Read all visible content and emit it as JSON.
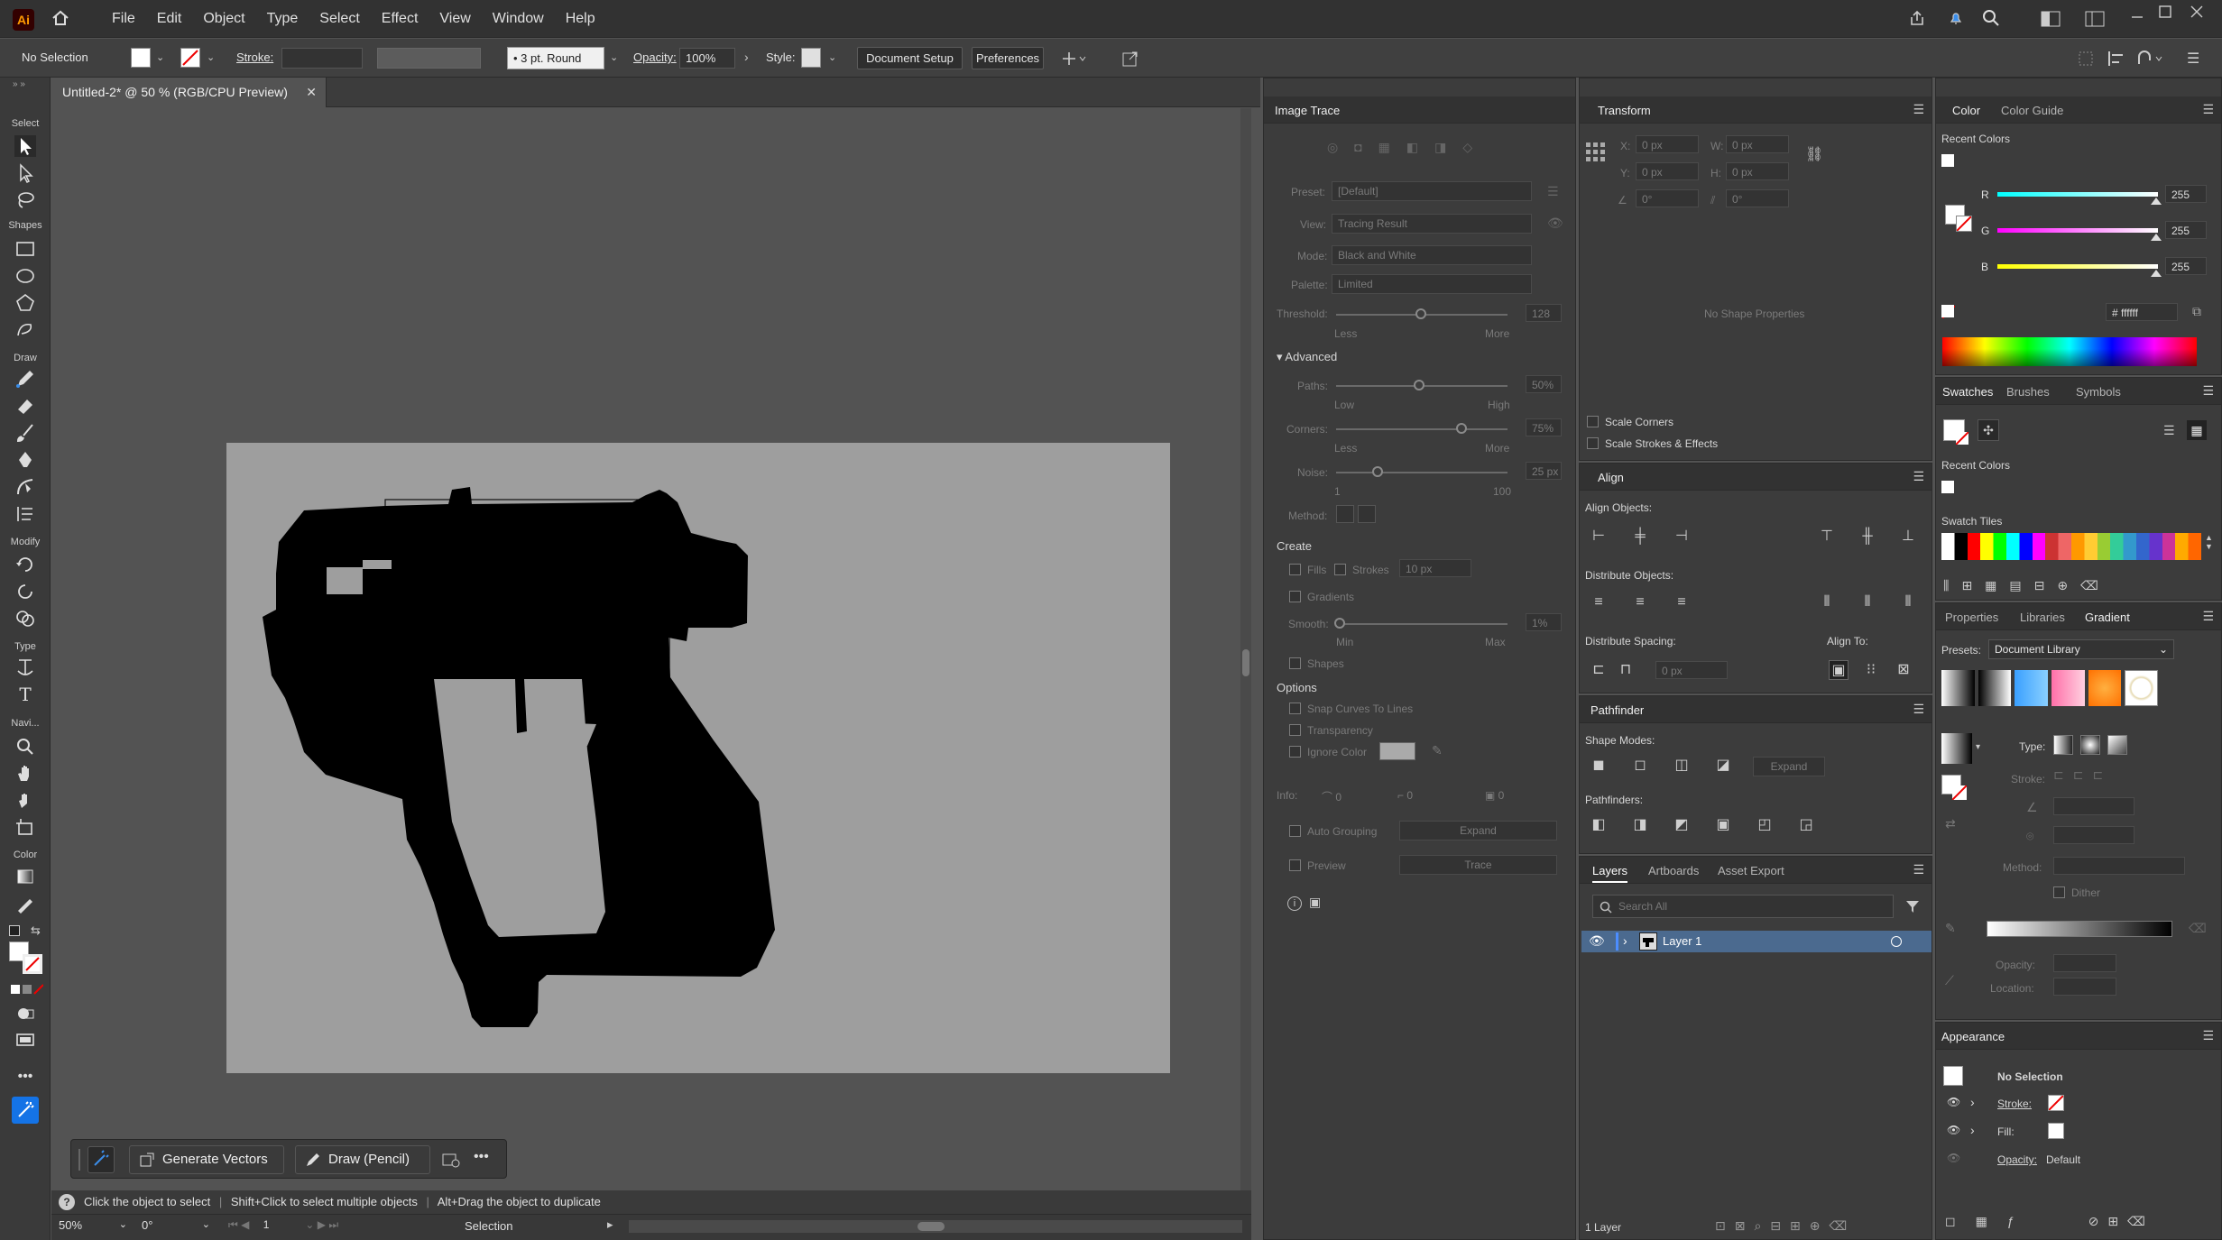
{
  "app": {
    "logo": "Ai",
    "menu": [
      "File",
      "Edit",
      "Object",
      "Type",
      "Select",
      "Effect",
      "View",
      "Window",
      "Help"
    ]
  },
  "control": {
    "selection": "No Selection",
    "stroke_label": "Stroke:",
    "brush": "3 pt. Round",
    "opacity_label": "Opacity:",
    "opacity": "100%",
    "style_label": "Style:",
    "doc_setup": "Document Setup",
    "preferences": "Preferences"
  },
  "doc": {
    "tab_title": "Untitled-2* @ 50 % (RGB/CPU Preview)"
  },
  "tools": {
    "select": "Select",
    "shapes": "Shapes",
    "draw": "Draw",
    "modify": "Modify",
    "type": "Type",
    "navi": "Navi...",
    "color": "Color"
  },
  "trace": {
    "title": "Image Trace",
    "preset_label": "Preset:",
    "preset": "[Default]",
    "view_label": "View:",
    "view": "Tracing Result",
    "mode_label": "Mode:",
    "mode": "Black and White",
    "palette_label": "Palette:",
    "palette": "Limited",
    "threshold_label": "Threshold:",
    "threshold": "128",
    "less": "Less",
    "more": "More",
    "advanced": "Advanced",
    "paths_label": "Paths:",
    "paths": "50%",
    "low": "Low",
    "high": "High",
    "corners_label": "Corners:",
    "corners": "75%",
    "noise_label": "Noise:",
    "noise": "25 px",
    "noise_min": "1",
    "noise_max": "100",
    "method_label": "Method:",
    "create": "Create",
    "fills": "Fills",
    "strokes": "Strokes",
    "stroke_px": "10 px",
    "gradients": "Gradients",
    "smooth_label": "Smooth:",
    "smooth": "1%",
    "min": "Min",
    "max": "Max",
    "shapes": "Shapes",
    "options": "Options",
    "snap": "Snap Curves To Lines",
    "transparency": "Transparency",
    "ignore": "Ignore Color",
    "info": "Info:",
    "info_a": "0",
    "info_b": "0",
    "info_c": "0",
    "auto": "Auto Grouping",
    "expand": "Expand",
    "preview": "Preview",
    "trace": "Trace"
  },
  "transform": {
    "title": "Transform",
    "x": "X:",
    "xv": "0 px",
    "w": "W:",
    "wv": "0 px",
    "y": "Y:",
    "yv": "0 px",
    "h": "H:",
    "hv": "0 px",
    "angle": "0°",
    "shear": "0°",
    "noshape": "No Shape Properties",
    "scale_corners": "Scale Corners",
    "scale_strokes": "Scale Strokes & Effects"
  },
  "align": {
    "title": "Align",
    "objects": "Align Objects:",
    "distribute": "Distribute Objects:",
    "spacing": "Distribute Spacing:",
    "align_to": "Align To:",
    "space": "0 px"
  },
  "pathfinder": {
    "title": "Pathfinder",
    "modes": "Shape Modes:",
    "expand": "Expand",
    "pathfinders": "Pathfinders:"
  },
  "layers": {
    "tabs": [
      "Layers",
      "Artboards",
      "Asset Export"
    ],
    "search": "Search All",
    "layer1": "Layer 1",
    "count": "1 Layer"
  },
  "color": {
    "tabs": [
      "Color",
      "Color Guide"
    ],
    "recent": "Recent Colors",
    "r": "R",
    "g": "G",
    "b": "B",
    "rv": "255",
    "gv": "255",
    "bv": "255",
    "hex": "ffffff"
  },
  "swatches": {
    "tabs": [
      "Swatches",
      "Brushes",
      "Symbols"
    ],
    "recent": "Recent Colors",
    "tiles": "Swatch Tiles"
  },
  "gradient": {
    "tabs": [
      "Properties",
      "Libraries",
      "Gradient"
    ],
    "presets_label": "Presets:",
    "presets": "Document Library",
    "type": "Type:",
    "stroke": "Stroke:",
    "method": "Method:",
    "dither": "Dither",
    "opacity": "Opacity:",
    "location": "Location:"
  },
  "appearance": {
    "title": "Appearance",
    "nosel": "No Selection",
    "stroke": "Stroke:",
    "fill": "Fill:",
    "opacity": "Opacity:",
    "opacity_val": "Default"
  },
  "context": {
    "gen": "Generate Vectors",
    "draw": "Draw (Pencil)"
  },
  "status": {
    "hint1": "Click the object to select",
    "hint2": "Shift+Click to select multiple objects",
    "hint3": "Alt+Drag the object to duplicate",
    "zoom": "50%",
    "rotation": "0°",
    "page": "1",
    "tool": "Selection"
  },
  "colors": {
    "accent": "#1473e6",
    "layer_sel": "#4b6a8f",
    "panel": "#3c3c3c",
    "dark": "#323232"
  }
}
